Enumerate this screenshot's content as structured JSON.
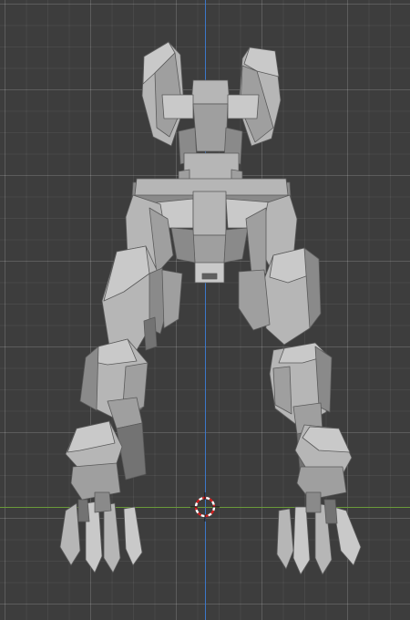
{
  "viewport": {
    "background_color": "#3d3d3d",
    "grid_color": "#4a4a4a",
    "x_axis_color": "#6a9a3a",
    "y_axis_color": "#3c77c8",
    "cursor_colors": [
      "#d42020",
      "#ffffff"
    ]
  },
  "model": {
    "type": "mech-robot-lower-body",
    "view": "front-orthographic",
    "shading": "solid-grey"
  }
}
